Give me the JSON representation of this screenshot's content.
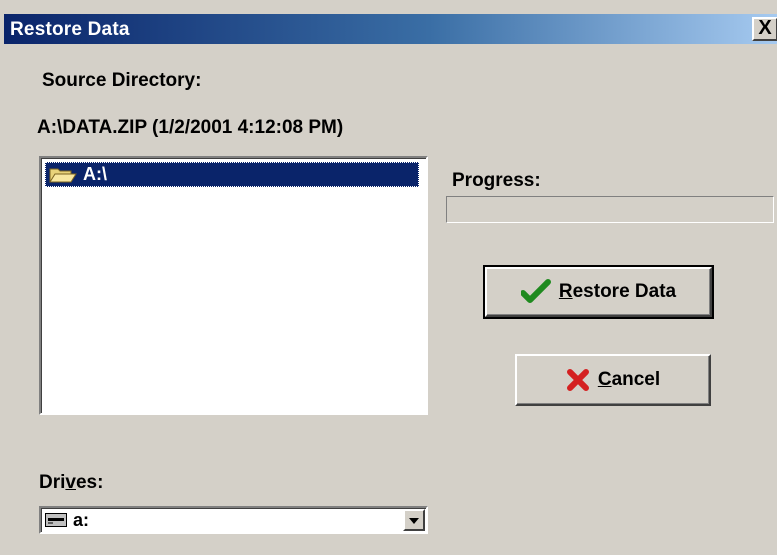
{
  "window": {
    "title": "Restore Data",
    "close_glyph": "X"
  },
  "source": {
    "label": "Source Directory:",
    "path": "A:\\DATA.ZIP (1/2/2001 4:12:08 PM)"
  },
  "directory_list": {
    "items": [
      {
        "label": "A:\\",
        "icon": "open-folder-icon",
        "selected": true
      }
    ]
  },
  "progress": {
    "label": "Progress:",
    "value_percent": 0
  },
  "buttons": {
    "restore": {
      "mnemonic": "R",
      "rest": "estore Data",
      "icon": "checkmark-icon"
    },
    "cancel": {
      "mnemonic": "C",
      "rest": "ancel",
      "icon": "x-mark-icon"
    }
  },
  "drives": {
    "label_pre": "Dri",
    "label_mnemonic": "v",
    "label_post": "es:",
    "selected_value": "a:",
    "icon": "floppy-drive-icon"
  },
  "colors": {
    "face": "#d4d0c8",
    "selection": "#0a246a",
    "check_green": "#1f8a1f",
    "cancel_red": "#d42020"
  }
}
